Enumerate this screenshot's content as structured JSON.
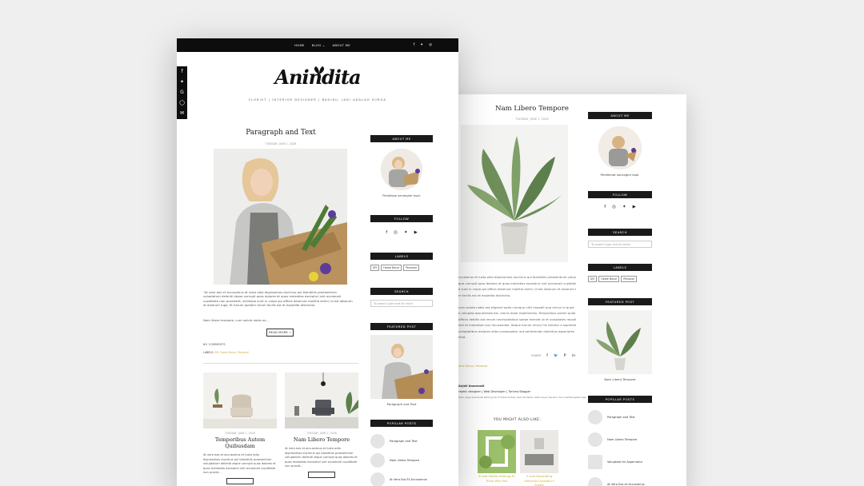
{
  "front": {
    "nav": [
      "HOME",
      "BLOG ⌄",
      "ABOUT ME"
    ],
    "social_icons": [
      "facebook-icon",
      "twitter-icon",
      "instagram-icon"
    ],
    "share_icons": [
      "facebook-icon",
      "twitter-icon",
      "google-plus-icon",
      "whatsapp-icon",
      "email-icon"
    ],
    "logo": "Anindita",
    "tagline": "FLORIST | INTERIOR DESIGNER | BAGIKU, JADI ADALAH SURGA",
    "post": {
      "title": "Paragraph and Text",
      "date": "TUESDAY, JUNE 1, 2026",
      "body_lines": [
        "\"At vero eos et accusamus et iusto odio dignissimos ducimus qui blanditiis praesentium",
        "voluptatum deleniti atque corrupti quos dolores et quas molestias excepturi sint occaecati",
        "cupiditate non provident, similique sunt in culpa qui officia deserunt mollitia animi, id est laborum",
        "et dolorum fuga. Et harum quidem rerum facilis est et expedita distinctio."
      ],
      "more": "Nam libero tempore, cum soluta nobis es...",
      "read_more": "READ MORE »",
      "comments": "NO COMMENTS",
      "labels_prefix": "LABELS:",
      "labels": "DIY, Home Decor, Personal"
    },
    "grid": [
      {
        "date": "TUESDAY, JUNE 1, 2026",
        "title": "Temporibus Autem Quibusdam",
        "body": "At vero eos et accusamus et iusto odio dignissimos ducimus qui blanditiis praesentium voluptatum deleniti atque corrupti quos dolores et quas molestias excepturi sint occaecati cupiditate non provid..."
      },
      {
        "date": "TUESDAY, JUNE 1, 2026",
        "title": "Nam Libero Tempore",
        "body": "At vero eos et accusamus et iusto odio dignissimos ducimus qui blanditiis praesentium voluptatum deleniti atque corrupti quos dolores et quas molestias excepturi sint occaecati cupiditate non provid..."
      }
    ],
    "sidebar": {
      "about_label": "ABOUT ME",
      "about_caption": "Perdiksse secangkir kopi.",
      "follow_label": "FOLLOW",
      "labels_label": "LABELS",
      "tags": [
        "DIY",
        "Home Decor",
        "Personal"
      ],
      "search_label": "SEARCH",
      "search_placeholder": "To search type and hit enter",
      "featured_label": "FEATURED POST",
      "featured_caption": "Paragraph and Text",
      "popular_label": "POPULAR POSTS",
      "popular": [
        "Paragraph and Text",
        "Nam Libero Tempore",
        "At Vero Eos Et Accusamus"
      ]
    }
  },
  "back": {
    "title": "Nam Libero Tempore",
    "date": "TUESDAY, JUNE 1, 2026",
    "body_lines": [
      "ccusamus et iusto odio dignissimos ducimus qui blanditiis praesentium voluptatum",
      "que corrupti quos dolores et quas molestias excepturi sint occaecati cupiditate non",
      "e sunt in culpa qui officia deserunt mollitia animi, id est laborum et dolorum fuga.",
      "m facilis est et expedita distinctio.",
      "",
      "cum soluta nobis est eligendi optio cumque nihil impedit quo minus id quod",
      "e voluptas assumenda est, omnis dolor repellendus. Temporibus autem quibusdam",
      "officiis debitis aut rerum necessitatibus saepe eveniet ut et voluptates repudiandae",
      "sint et molestiae non recusandae. Itaque earum rerum hic tenetur a sapiente",
      "voluptatibus maiores alias consequatur aut perferendis doloribus asperiores",
      "ellat."
    ],
    "share_label": "SHARE:",
    "share_icons": [
      "facebook-icon",
      "twitter-icon",
      "pinterest-icon",
      "linkedin-icon"
    ],
    "labels_link": "ome Decor, Personal",
    "author_lines": [
      "Anjeli Anaravati",
      "raphic designer | Web Developer | Tanima Blogger",
      "Halo, saya anaravati keliling dan Fundamentals, Kalo terdalam lebih bayar bersam dan membengaka laga"
    ],
    "also_title": "YOU MIGHT ALSO LIKE:",
    "also": [
      "8 Leaf Marker Settings to Tricks Who Fish",
      "5 Leaf Decorating Elements Outside Ini Puzzle"
    ],
    "sidebar": {
      "about_label": "ABOUT ME",
      "about_caption": "Perdikmat secangkir kopi.",
      "follow_label": "FOLLOW",
      "search_label": "SEARCH",
      "search_placeholder": "To search type and hit enter",
      "labels_label": "LABELS",
      "tags": [
        "DIY",
        "Home Decor",
        "Personal"
      ],
      "featured_label": "FEATURED POST",
      "featured_caption": "Nam Libero Tempore",
      "popular_label": "POPULAR POSTS",
      "popular": [
        "Paragraph and Text",
        "Nam Libero Tempore",
        "Voluptate for Aspernatur",
        "At Vero Eos et Accusamus"
      ]
    }
  },
  "colors": {
    "accent": "#c9a93a",
    "bar": "#0d0d0d",
    "background": "#efefef"
  }
}
